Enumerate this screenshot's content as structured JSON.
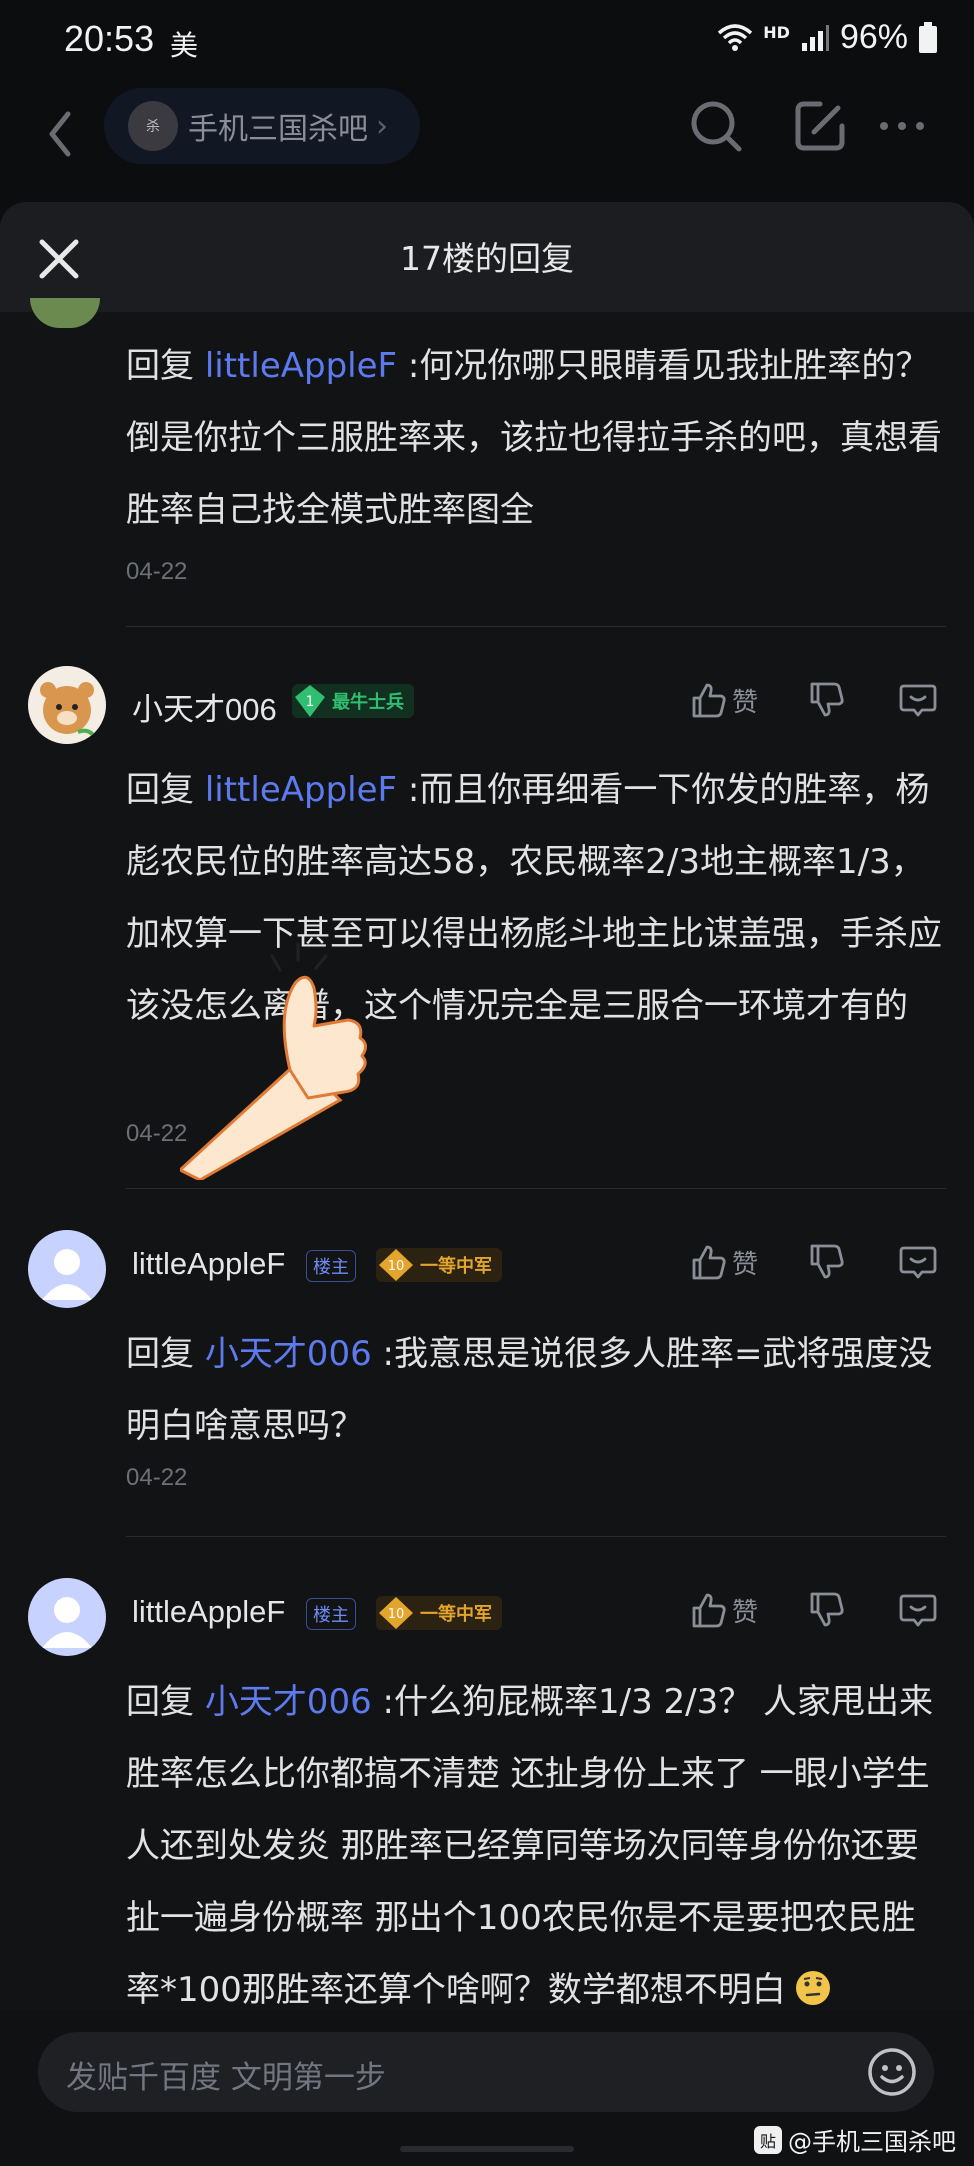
{
  "status_bar": {
    "time": "20:53",
    "carrier": "美",
    "hd": "HD",
    "battery": "96%"
  },
  "top_nav": {
    "forum_name": "手机三国杀吧",
    "forum_avatar_text": "杀",
    "chevron": "›"
  },
  "sheet": {
    "title": "17楼的回复"
  },
  "replies": [
    {
      "prefix": "回复 ",
      "mention": "littleAppleF",
      "text": " :何况你哪只眼睛看见我扯胜率的？倒是你拉个三服胜率来，该拉也得拉手杀的吧，真想看胜率自己找全模式胜率图全",
      "date": "04-22"
    },
    {
      "user": "小天才006",
      "level": "1",
      "title": "最牛士兵",
      "like_label": "赞",
      "prefix": "回复 ",
      "mention": "littleAppleF",
      "text": " :而且你再细看一下你发的胜率，杨彪农民位的胜率高达58，农民概率2/3地主概率1/3，加权算一下甚至可以得出杨彪斗地主比谋盖强，手杀应该没怎么离谱，这个情况完全是三服合一环境才有的",
      "date": "04-22"
    },
    {
      "user": "littleAppleF",
      "owner_tag": "楼主",
      "level": "10",
      "title": "一等中军",
      "like_label": "赞",
      "prefix": "回复 ",
      "mention": "小天才006",
      "text": " :我意思是说很多人胜率=武将强度没明白啥意思吗？",
      "date": "04-22"
    },
    {
      "user": "littleAppleF",
      "owner_tag": "楼主",
      "level": "10",
      "title": "一等中军",
      "like_label": "赞",
      "prefix": "回复 ",
      "mention": "小天才006",
      "text": " :什么狗屁概率1/3 2/3？ 人家甩出来胜率怎么比你都搞不清楚 还扯身份上来了 一眼小学生人还到处发炎 那胜率已经算同等场次同等身份你还要扯一遍身份概率 那出个100农民你是不是要把农民胜率*100那胜率还算个啥啊？数学都想不明白"
    }
  ],
  "composer": {
    "placeholder": "发贴千百度 文明第一步"
  },
  "watermark": {
    "text": "@手机三国杀吧",
    "box": "贴"
  },
  "colors": {
    "mention": "#5d7bef",
    "badge_green": "#2fbf71",
    "badge_gold": "#e3a52b"
  }
}
